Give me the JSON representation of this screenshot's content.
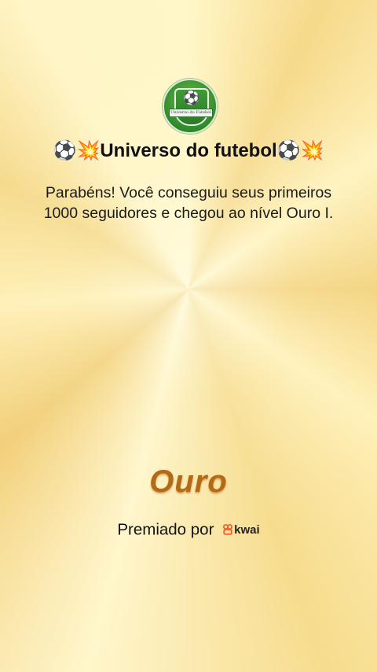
{
  "profile": {
    "logo_text": "Universo do Futebol",
    "title": "⚽💥Universo do futebol⚽💥"
  },
  "message": "Parabéns! Você conseguiu seus primeiros 1000 seguidores e chegou ao nível Ouro I.",
  "level": {
    "label": "Ouro",
    "color": "#b36a16"
  },
  "award": {
    "prefix": "Premiado por",
    "brand": "kwai",
    "brand_icon": "kwai-logo-icon",
    "brand_color": "#ff5b2e"
  },
  "ball_icon": "⚽"
}
